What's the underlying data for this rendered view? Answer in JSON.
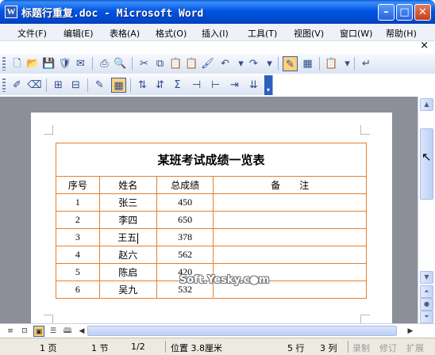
{
  "window": {
    "title": "标题行重复.doc - Microsoft Word",
    "app_icon_letter": "W",
    "minimize": "–",
    "maximize": "□",
    "close": "✕"
  },
  "menu": {
    "items": [
      "文件(F)",
      "编辑(E)",
      "表格(A)",
      "格式(O)",
      "插入(I)",
      "工具(T)",
      "视图(V)",
      "窗口(W)",
      "帮助(H)"
    ],
    "close_doc": "×"
  },
  "toolbar": {
    "standard": [
      "new-icon",
      "open-icon",
      "save-icon",
      "permission-icon",
      "print-icon",
      "print-preview-icon",
      "cut-icon",
      "copy-icon",
      "paste-icon",
      "format-painter-icon",
      "undo-icon",
      "redo-icon",
      "insert-table-icon",
      "table-grid-icon",
      "paste-special-icon",
      "show-hide-icon"
    ],
    "tables": [
      "draw-table-icon",
      "eraser-icon",
      "insert-rows-icon",
      "insert-columns-icon",
      "table-autoformat-icon",
      "table-grid-active-icon",
      "sort-ascending-icon",
      "sort-descending-icon",
      "autosum-icon",
      "merge-cells-icon",
      "split-cells-icon",
      "distribute-icon",
      "column-icon"
    ]
  },
  "document": {
    "table": {
      "title": "某班考试成绩一览表",
      "headers": [
        "序号",
        "姓名",
        "总成绩",
        "备　　注"
      ],
      "rows": [
        [
          "1",
          "张三",
          "450",
          ""
        ],
        [
          "2",
          "李四",
          "650",
          ""
        ],
        [
          "3",
          "王五",
          "378",
          ""
        ],
        [
          "4",
          "赵六",
          "562",
          ""
        ],
        [
          "5",
          "陈启",
          "420",
          ""
        ],
        [
          "6",
          "吴九",
          "532",
          ""
        ]
      ]
    },
    "watermark": "Soft.Yesky.c●m"
  },
  "statusbar": {
    "page": "1 页",
    "section": "1 节",
    "page_count": "1/2",
    "position": "位置 3.8厘米",
    "line": "5 行",
    "column": "3 列",
    "rec": "录制",
    "trk": "修订",
    "ext": "扩展"
  },
  "colors": {
    "titlebar": "#0055e5",
    "table_border": "#e67f2e",
    "workspace": "#8c8f97"
  }
}
